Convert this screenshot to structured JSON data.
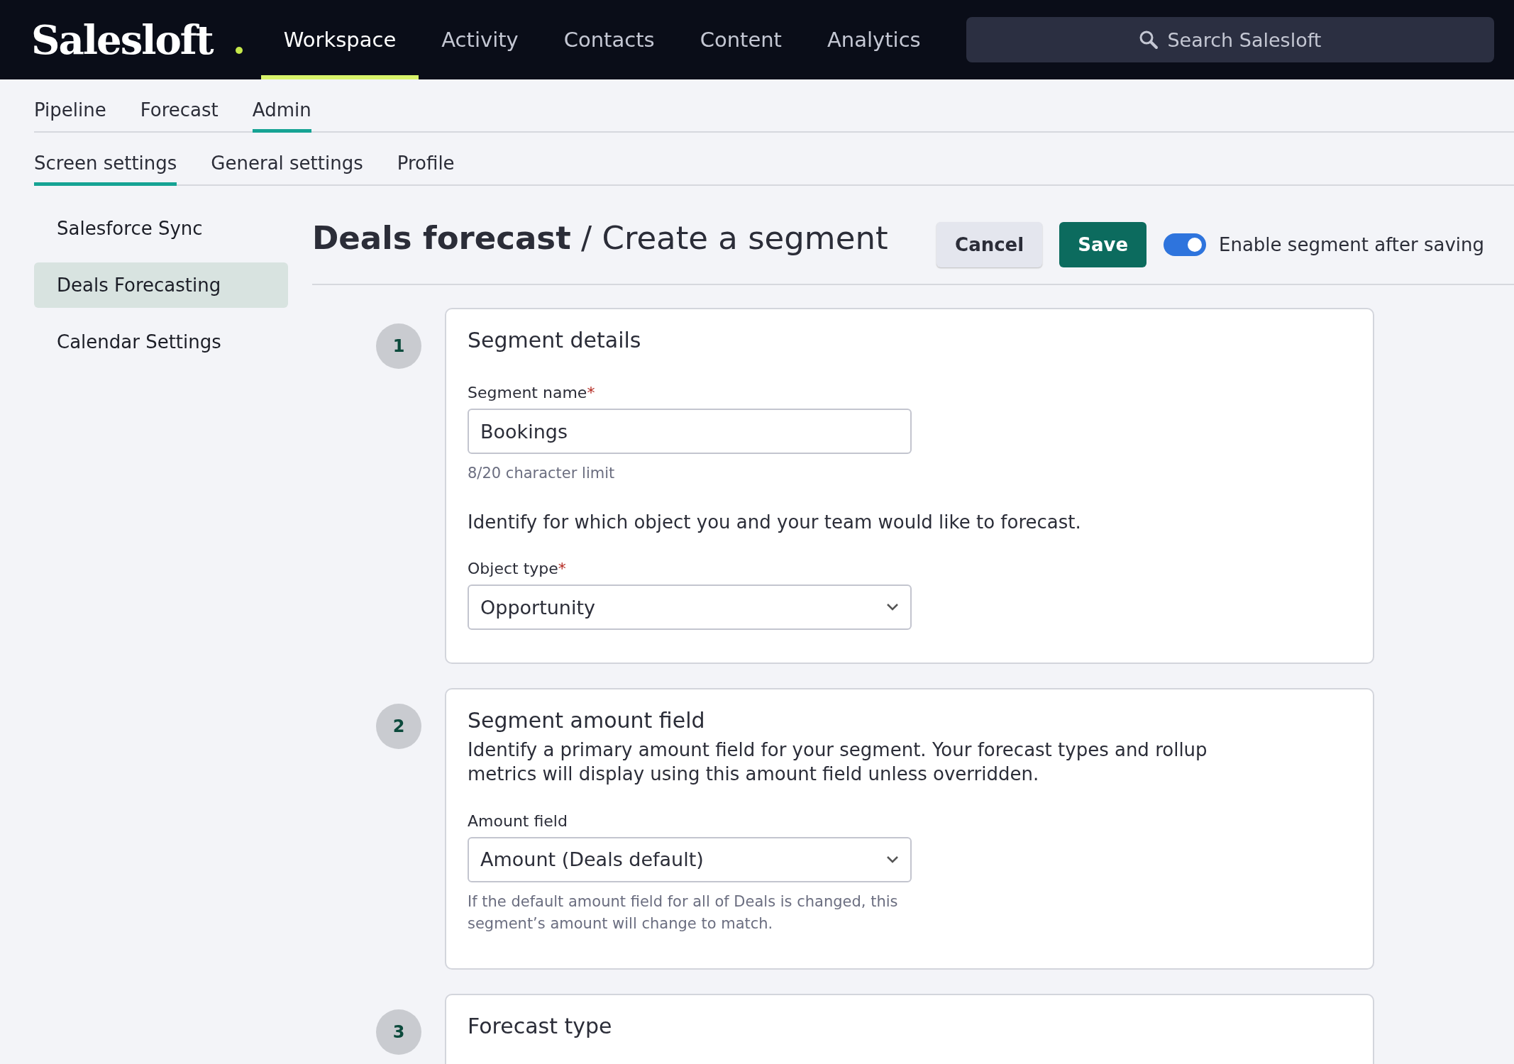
{
  "app": {
    "logo": "Salesloft",
    "nav": [
      {
        "label": "Workspace",
        "selected": true
      },
      {
        "label": "Activity",
        "selected": false
      },
      {
        "label": "Contacts",
        "selected": false
      },
      {
        "label": "Content",
        "selected": false
      },
      {
        "label": "Analytics",
        "selected": false
      }
    ],
    "search": {
      "placeholder": "Search Salesloft"
    }
  },
  "tabs": [
    {
      "label": "Pipeline",
      "selected": false
    },
    {
      "label": "Forecast",
      "selected": false
    },
    {
      "label": "Admin",
      "selected": true
    }
  ],
  "subtabs": [
    {
      "label": "Screen settings",
      "selected": true
    },
    {
      "label": "General settings",
      "selected": false
    },
    {
      "label": "Profile",
      "selected": false
    }
  ],
  "sidebar": {
    "items": [
      {
        "label": "Salesforce Sync",
        "selected": false
      },
      {
        "label": "Deals Forecasting",
        "selected": true
      },
      {
        "label": "Calendar Settings",
        "selected": false
      }
    ]
  },
  "header": {
    "title": "Deals forecast",
    "separator": "/",
    "subtitle": "Create a segment",
    "buttons": [
      {
        "label": "Cancel",
        "kind": "secondary"
      },
      {
        "label": "Save",
        "kind": "primary"
      }
    ],
    "toggle": {
      "label": "Enable segment after saving",
      "on": true
    }
  },
  "steps": [
    {
      "number": "1",
      "title": "Segment details",
      "blocks": [
        {
          "kind": "input",
          "label": "Segment name",
          "required_mark": "*",
          "value": "Bookings",
          "hint": "8/20 character limit"
        },
        {
          "kind": "text",
          "text": "Identify for which object you and your team would like to forecast."
        },
        {
          "kind": "select",
          "label": "Object type",
          "required_mark": "*",
          "value": "Opportunity"
        }
      ]
    },
    {
      "number": "2",
      "title": "Segment amount field",
      "blocks": [
        {
          "kind": "text",
          "text": "Identify a primary amount field for your segment. Your forecast types and rollup metrics will display using this amount field unless overridden."
        },
        {
          "kind": "select",
          "label": "Amount field",
          "value": "Amount (Deals default)",
          "hint": "If the default amount field for all of Deals is changed, this segment’s amount will change to match."
        }
      ]
    },
    {
      "number": "3",
      "title": "Forecast type"
    }
  ]
}
